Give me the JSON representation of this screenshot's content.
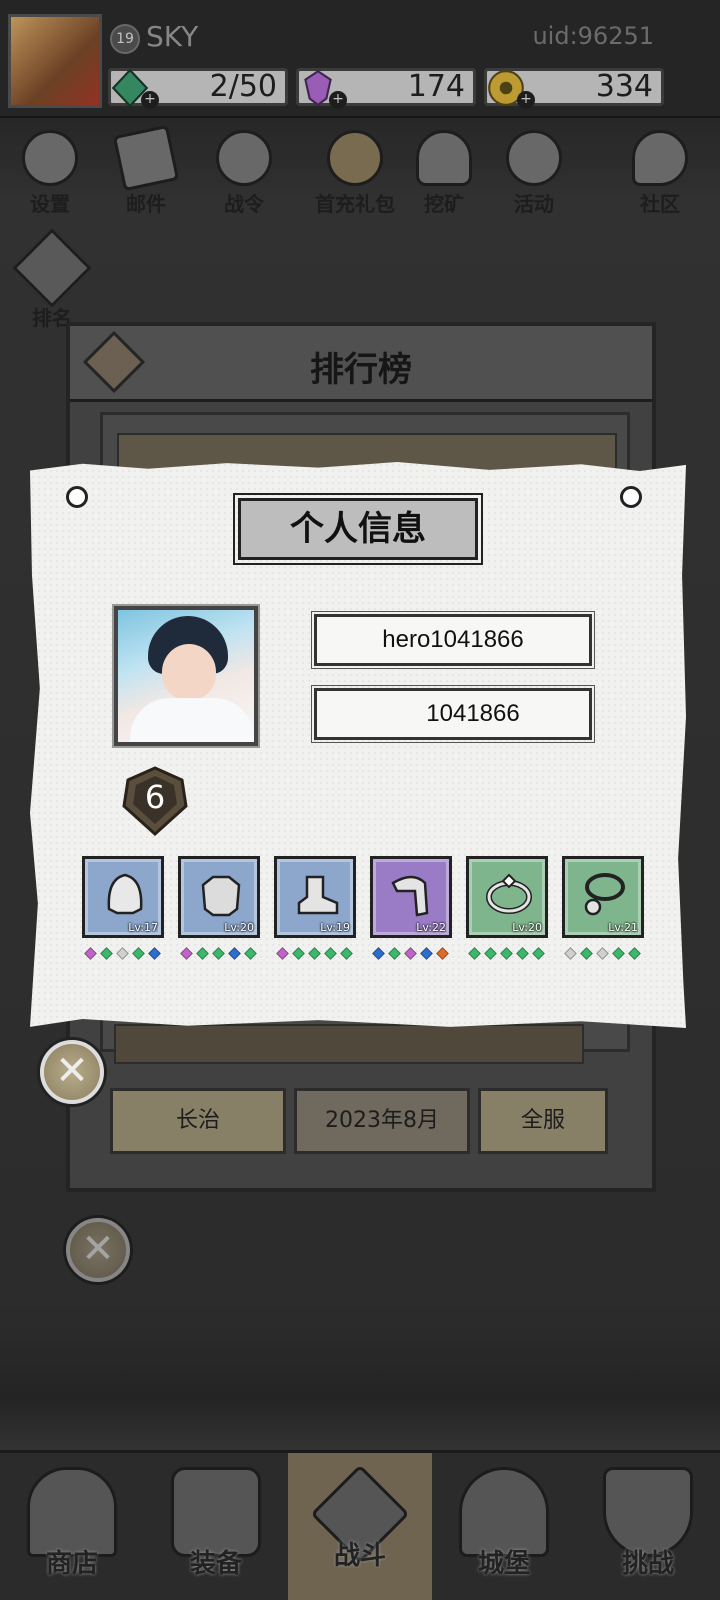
{
  "header": {
    "level": "19",
    "player_name": "SKY",
    "uid": "uid:96251",
    "stamina": "2/50",
    "gems": "174",
    "gold": "334",
    "colors": {
      "stamina": "#3c9a6e",
      "gem": "#b06ad0",
      "gold": "#d7b23a"
    }
  },
  "top_menu": [
    {
      "label": "设置",
      "icon": "gear-icon"
    },
    {
      "label": "邮件",
      "icon": "mail-icon"
    },
    {
      "label": "战令",
      "icon": "battle-pass-icon"
    },
    {
      "label": "首充礼包",
      "icon": "gift-bag-icon"
    },
    {
      "label": "挖矿",
      "icon": "mining-icon"
    },
    {
      "label": "活动",
      "icon": "event-icon"
    },
    {
      "label": "社区",
      "icon": "community-icon"
    }
  ],
  "ranking_shortcut": {
    "label": "排名",
    "icon": "ranking-icon"
  },
  "ranking_panel": {
    "title": "排行榜",
    "filters": [
      "长治",
      "2023年8月",
      "全服"
    ]
  },
  "profile_popup": {
    "title": "个人信息",
    "name": "hero1041866",
    "id": "1041866",
    "level": "6",
    "equipment": [
      {
        "slot": "helmet-icon",
        "level_label": "Lv:17",
        "rarity": "blue",
        "gems": [
          "#c064c8",
          "#3cb86a",
          "#d0d0d0",
          "#3cb86a",
          "#2e6ccf"
        ]
      },
      {
        "slot": "armor-icon",
        "level_label": "Lv:20",
        "rarity": "blue",
        "gems": [
          "#c064c8",
          "#3cb86a",
          "#3cb86a",
          "#2e6ccf",
          "#3cb86a"
        ]
      },
      {
        "slot": "boots-icon",
        "level_label": "Lv:19",
        "rarity": "blue",
        "gems": [
          "#c064c8",
          "#3cb86a",
          "#3cb86a",
          "#3cb86a",
          "#3cb86a"
        ]
      },
      {
        "slot": "gloves-icon",
        "level_label": "Lv:22",
        "rarity": "purple",
        "gems": [
          "#2e6ccf",
          "#3cb86a",
          "#c064c8",
          "#2e6ccf",
          "#e06a2a"
        ]
      },
      {
        "slot": "ring-icon",
        "level_label": "Lv:20",
        "rarity": "green",
        "gems": [
          "#3cb86a",
          "#3cb86a",
          "#3cb86a",
          "#3cb86a",
          "#3cb86a"
        ]
      },
      {
        "slot": "necklace-icon",
        "level_label": "Lv:21",
        "rarity": "green",
        "gems": [
          "#d0d0d0",
          "#3cb86a",
          "#d0d0d0",
          "#3cb86a",
          "#3cb86a"
        ]
      }
    ]
  },
  "bottom_nav": [
    {
      "label": "商店",
      "icon": "shop-icon"
    },
    {
      "label": "装备",
      "icon": "backpack-icon"
    },
    {
      "label": "战斗",
      "icon": "crossed-swords-icon",
      "active": true
    },
    {
      "label": "城堡",
      "icon": "castle-icon"
    },
    {
      "label": "挑战",
      "icon": "challenge-shield-icon"
    }
  ]
}
